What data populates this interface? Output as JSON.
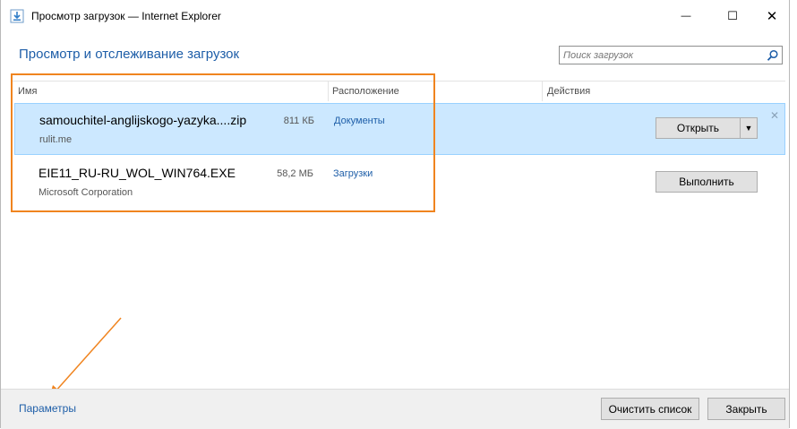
{
  "window": {
    "title": "Просмотр загрузок — Internet Explorer",
    "min_glyph": "—",
    "max_glyph": "☐",
    "close_glyph": "✕"
  },
  "header": {
    "title": "Просмотр и отслеживание загрузок",
    "search_placeholder": "Поиск загрузок",
    "search_icon": "search-icon"
  },
  "columns": [
    "Имя",
    "Расположение",
    "Действия"
  ],
  "downloads": [
    {
      "name": "samouchitel-anglijskogo-yazyka....zip",
      "source": "rulit.me",
      "size": "811 КБ",
      "location": "Документы",
      "action": "Открыть",
      "dropdown_glyph": "▼",
      "dismiss_glyph": "✕",
      "selected": true
    },
    {
      "name": "EIE11_RU-RU_WOL_WIN764.EXE",
      "source": "Microsoft Corporation",
      "size": "58,2 МБ",
      "location": "Загрузки",
      "action": "Выполнить",
      "selected": false
    }
  ],
  "footer": {
    "settings_link": "Параметры",
    "clear_button": "Очистить список",
    "close_button": "Закрыть"
  },
  "colors": {
    "accent": "#1e5ea8",
    "selection": "#cce8ff",
    "annotation": "#f0841f"
  }
}
